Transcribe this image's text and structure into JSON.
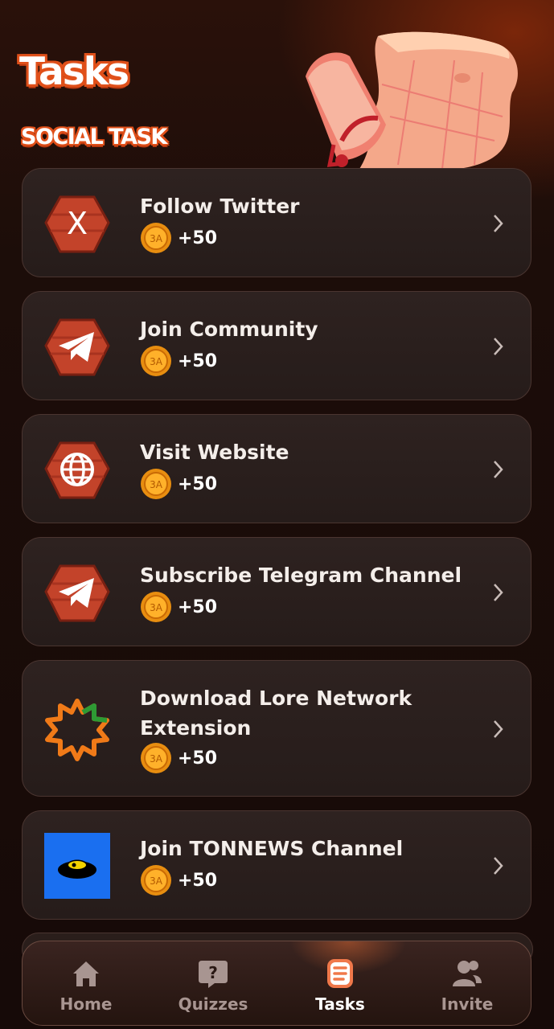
{
  "header": {
    "title": "Tasks",
    "section_label": "SOCIAL TASK"
  },
  "tasks": [
    {
      "name": "Follow Twitter",
      "reward": "+50",
      "icon": "x-logo-icon"
    },
    {
      "name": "Join Community",
      "reward": "+50",
      "icon": "telegram-icon"
    },
    {
      "name": "Visit Website",
      "reward": "+50",
      "icon": "globe-icon"
    },
    {
      "name": "Subscribe Telegram Channel",
      "reward": "+50",
      "icon": "telegram-icon"
    },
    {
      "name": "Download Lore Network Extension",
      "reward": "+50",
      "icon": "lore-network-logo-icon"
    },
    {
      "name": "Join TONNEWS Channel",
      "reward": "+50",
      "icon": "tonnews-logo-icon"
    }
  ],
  "nav": [
    {
      "label": "Home",
      "icon": "home-icon",
      "active": false
    },
    {
      "label": "Quizzes",
      "icon": "question-icon",
      "active": false
    },
    {
      "label": "Tasks",
      "icon": "tasks-icon",
      "active": true
    },
    {
      "label": "Invite",
      "icon": "users-icon",
      "active": false
    }
  ],
  "colors": {
    "accent": "#e0501a",
    "card_bg": "#2a1e1b",
    "page_bg": "#1a0c09"
  }
}
